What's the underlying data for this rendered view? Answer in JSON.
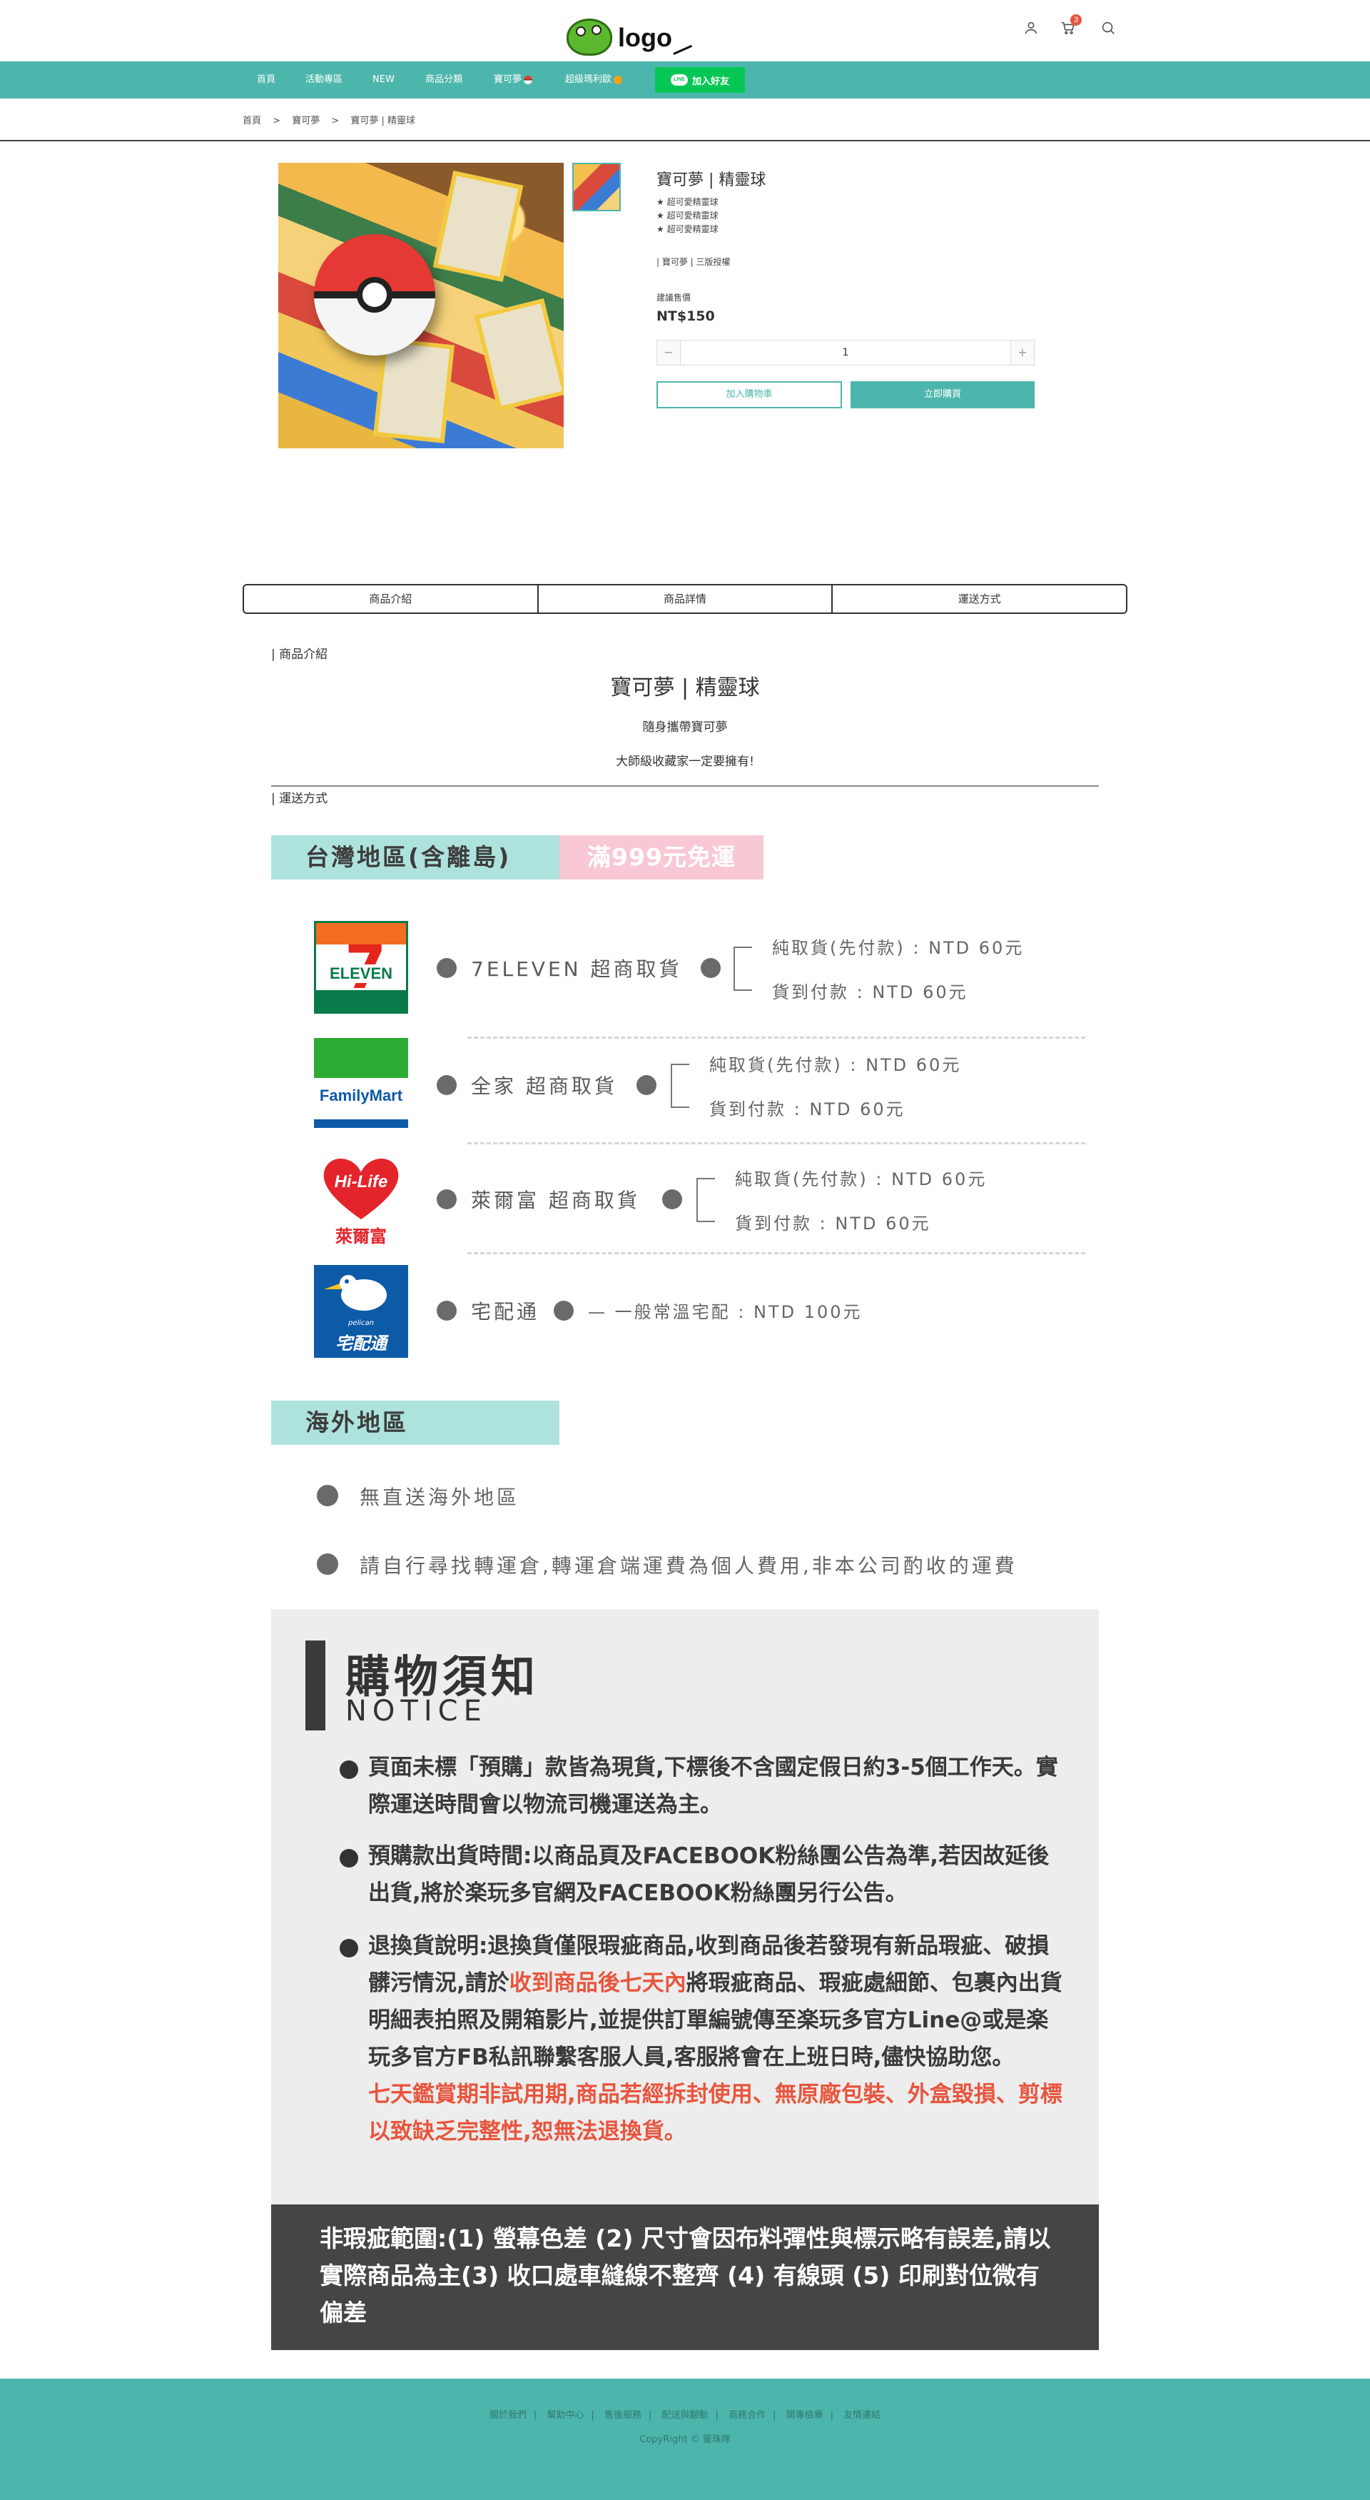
{
  "header": {
    "logo_text": "logo",
    "cart_count": "3"
  },
  "nav": {
    "items": [
      "首頁",
      "活動專區",
      "NEW",
      "商品分類",
      "寶可夢",
      "超級瑪利歐"
    ],
    "line_button": "加入好友",
    "line_logo": "LINE"
  },
  "breadcrumb": [
    "首頁",
    ">",
    "寶可夢",
    ">",
    "寶可夢 | 精靈球"
  ],
  "product": {
    "title": "寶可夢 | 精靈球",
    "bullets": [
      "★ 超可愛精靈球",
      "★ 超可愛精靈球",
      "★ 超可愛精靈球"
    ],
    "tags": "| 寶可夢 | 三版授權",
    "price_label": "建議售價",
    "price": "NT$150",
    "quantity": "1",
    "minus": "−",
    "plus": "+",
    "add_to_cart": "加入購物車",
    "buy_now": "立即購買"
  },
  "tabs": [
    "商品介紹",
    "商品詳情",
    "運送方式"
  ],
  "intro": {
    "section_label": "| 商品介紹",
    "title": "寶可夢 | 精靈球",
    "line1": "隨身攜帶寶可夢",
    "line2": "大師級收藏家一定要擁有!"
  },
  "shipping": {
    "section_label": "| 運送方式",
    "taiwan_band": "台灣地區(含離島)",
    "free_band": "滿999元免運",
    "seven_logo_text": "ELEVEN",
    "seven_name": "7ELEVEN 超商取貨",
    "seven_fee1": "純取貨(先付款) : NTD 60元",
    "seven_fee2": "貨到付款 : NTD 60元",
    "family_logo_text": "FamilyMart",
    "family_name": "全家 超商取貨",
    "family_fee1": "純取貨(先付款) : NTD 60元",
    "family_fee2": "貨到付款 : NTD 60元",
    "hilife_logo_text": "Hi-Life",
    "hilife_logo_sub": "萊爾富",
    "hilife_name": "萊爾富 超商取貨",
    "hilife_fee1": "純取貨(先付款) : NTD 60元",
    "hilife_fee2": "貨到付款 : NTD 60元",
    "tqb_logo_text": "宅配通",
    "tqb_logo_small": "pelican",
    "tqb_name": "宅配通",
    "tqb_fee": "— 一般常溫宅配 : NTD 100元",
    "overseas_band": "海外地區",
    "overseas_line1": "無直送海外地區",
    "overseas_line2": "請自行尋找轉運倉,轉運倉端運費為個人費用,非本公司酌收的運費"
  },
  "notice": {
    "title": "購物須知",
    "subtitle": "NOTICE",
    "item1": "頁面未標「預購」款皆為現貨,下標後不含國定假日約3-5個工作天。實際運送時間會以物流司機運送為主。",
    "item2": "預購款出貨時間:以商品頁及FACEBOOK粉絲團公告為準,若因故延後出貨,將於楽玩多官網及FACEBOOK粉絲團另行公告。",
    "item3_a": "退換貨說明:退換貨僅限瑕疵商品,收到商品後若發現有新品瑕疵、破損髒污情況,請於",
    "item3_red": "收到商品後七天內",
    "item3_b": "將瑕疵商品、瑕疵處細節、包裹內出貨明細表拍照及開箱影片,並提供訂單編號傳至楽玩多官方Line@或是楽玩多官方FB私訊聯繫客服人員,客服將會在上班日時,儘快協助您。",
    "item3_warning": "七天鑑賞期非試用期,商品若經拆封使用、無原廠包裝、外盒毀損、剪標以致缺乏完整性,恕無法退換貨。",
    "defect_scope": "非瑕疵範圍:(1) 螢幕色差 (2) 尺寸會因布料彈性與標示略有誤差,請以實際商品為主(3) 收口處車縫線不整齊 (4) 有線頭 (5) 印刷對位微有偏差"
  },
  "footer": {
    "links": [
      "關於我們",
      "幫助中心",
      "售後服務",
      "配送與翻動",
      "商務合作",
      "開專檢舉",
      "友情連結"
    ],
    "copyright": "CopyRight © 靈珠隊"
  },
  "colors": {
    "primary": "#4db6ac",
    "line_green": "#06c755",
    "band_teal": "#aee3dd",
    "band_pink": "#f8c8d4",
    "notice_red": "#e8553d",
    "footer_text": "#2f7870"
  }
}
